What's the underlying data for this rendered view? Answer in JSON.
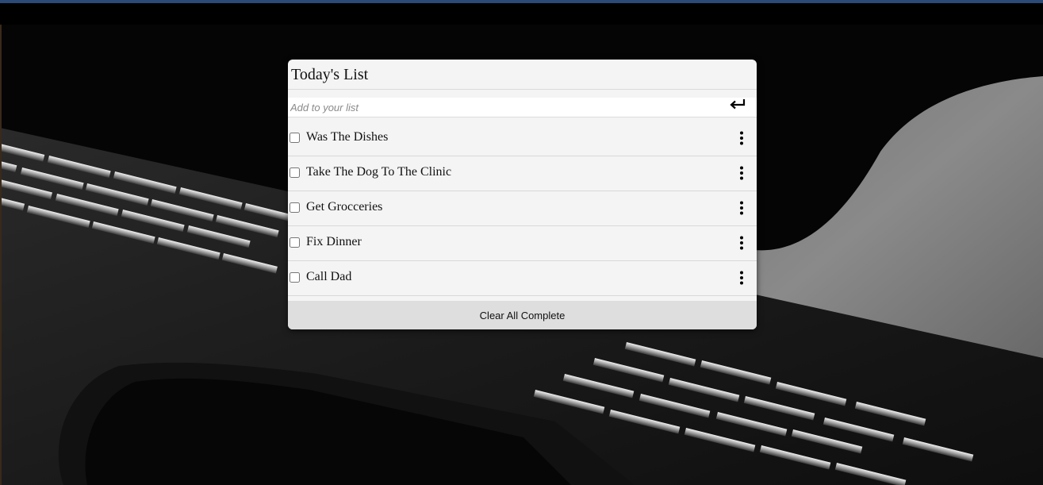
{
  "list": {
    "title": "Today's List",
    "add_placeholder": "Add to your list",
    "add_value": "",
    "submit_icon": "enter-arrow-icon",
    "items": [
      {
        "label": "Was The Dishes",
        "checked": false,
        "menu_icon": "kebab-menu-icon"
      },
      {
        "label": "Take The Dog To The Clinic",
        "checked": false,
        "menu_icon": "kebab-menu-icon"
      },
      {
        "label": "Get Grocceries",
        "checked": false,
        "menu_icon": "kebab-menu-icon"
      },
      {
        "label": "Fix Dinner",
        "checked": false,
        "menu_icon": "kebab-menu-icon"
      },
      {
        "label": "Call Dad",
        "checked": false,
        "menu_icon": "kebab-menu-icon"
      }
    ],
    "clear_label": "Clear All Complete"
  },
  "colors": {
    "card_bg": "#f4f4f4",
    "clear_bg": "#dedede",
    "top_strip": "#2b4a78",
    "page_bg": "#050505"
  }
}
